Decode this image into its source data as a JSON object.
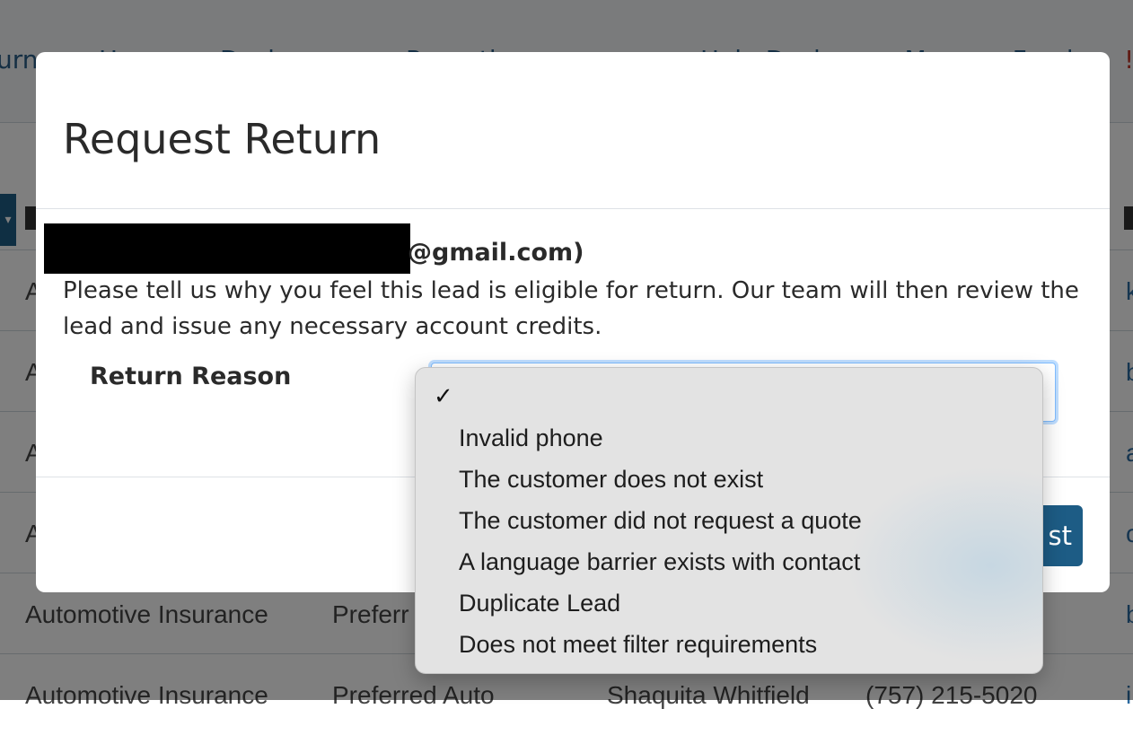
{
  "background": {
    "nav": [
      "urns",
      "H",
      "Dash",
      "Reporting",
      "Help Desk",
      "Manage Funds",
      "!"
    ],
    "rows": [
      [
        "A",
        "",
        "",
        "",
        "k"
      ],
      [
        "A",
        "",
        "",
        "",
        "b"
      ],
      [
        "A",
        "",
        "",
        "",
        "a"
      ],
      [
        "A",
        "",
        "",
        "",
        "c"
      ],
      [
        "Automotive Insurance",
        "Preferr",
        "",
        "",
        "b"
      ],
      [
        "Automotive Insurance",
        "Preferred Auto",
        "Shaquita Whitfield",
        "(757) 215-5020",
        "i"
      ]
    ]
  },
  "modal": {
    "title": "Request Return",
    "email_suffix": "@gmail.com)",
    "intro": "Please tell us why you feel this lead is eligible for return. Our team will then review the lead and issue any necessary account credits.",
    "return_reason_label": "Return Reason",
    "submit_label": "st"
  },
  "dropdown": {
    "selected": "",
    "options": [
      "",
      "Invalid phone",
      "The customer does not exist",
      "The customer did not request a quote",
      "A language barrier exists with contact",
      "Duplicate Lead",
      "Does not meet filter requirements"
    ]
  },
  "colors": {
    "primary_button": "#1d5c85",
    "focus_ring": "#80bdff",
    "link": "#2b6aa0"
  },
  "icons": [
    "checkmark-icon",
    "chevron-down-icon",
    "help-dot-icon",
    "bell-icon"
  ]
}
